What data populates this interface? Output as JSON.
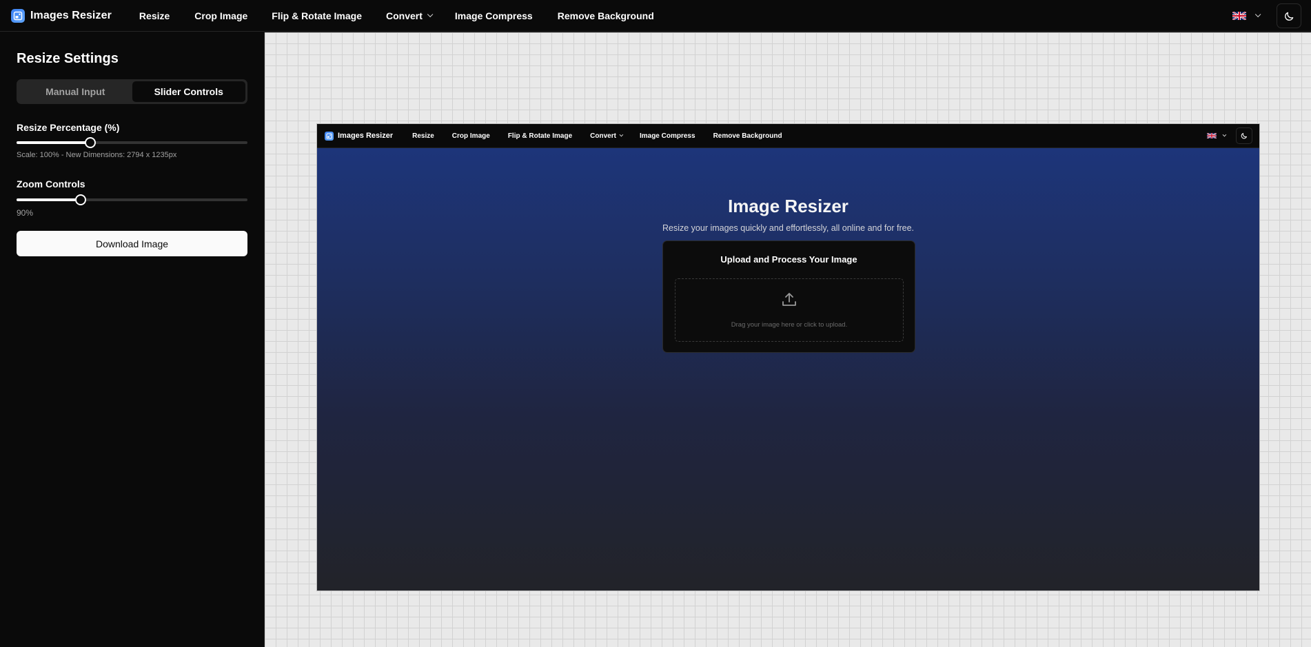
{
  "app": {
    "brand": "Images Resizer",
    "nav": [
      "Resize",
      "Crop Image",
      "Flip & Rotate Image",
      "Convert",
      "Image Compress",
      "Remove Background"
    ],
    "language_icon": "uk-flag-icon",
    "theme_icon": "moon-icon"
  },
  "sidebar": {
    "title": "Resize Settings",
    "tabs": [
      "Manual Input",
      "Slider Controls"
    ],
    "active_tab": "Slider Controls",
    "resize": {
      "label": "Resize Percentage (%)",
      "value": 0.32,
      "info": "Scale: 100% - New Dimensions: 2794 x 1235px"
    },
    "zoom": {
      "label": "Zoom Controls",
      "value": 0.277,
      "display": "90%"
    },
    "download_label": "Download Image"
  },
  "preview": {
    "brand": "Images Resizer",
    "nav": [
      "Resize",
      "Crop Image",
      "Flip & Rotate Image",
      "Convert",
      "Image Compress",
      "Remove Background"
    ],
    "title": "Image Resizer",
    "subtitle": "Resize your images quickly and effortlessly, all online and for free.",
    "upload_title": "Upload and Process Your Image",
    "drop_text": "Drag your image here or click to upload.",
    "upload_icon": "upload-icon"
  },
  "colors": {
    "accent": "#3b82f6",
    "background": "#0a0a0a",
    "canvas": "#e9e9e9",
    "hero_top": "#1d357a",
    "hero_bottom": "#222329"
  }
}
